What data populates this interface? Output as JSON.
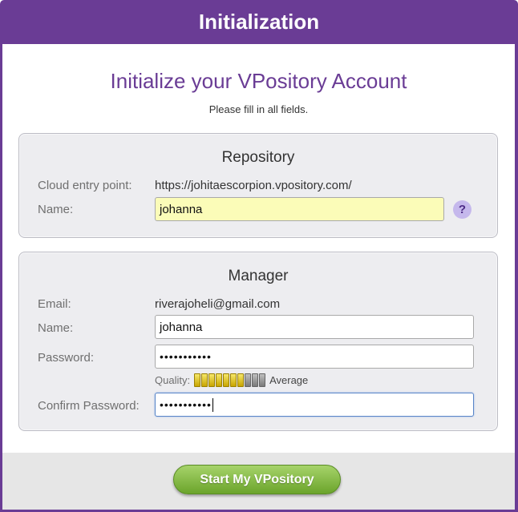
{
  "window": {
    "title": "Initialization"
  },
  "header": {
    "heading": "Initialize your VPository Account",
    "subheading": "Please fill in all fields."
  },
  "repository": {
    "title": "Repository",
    "cloud_label": "Cloud entry point:",
    "cloud_value": "https://johitaescorpion.vpository.com/",
    "name_label": "Name:",
    "name_value": "johanna",
    "help_symbol": "?"
  },
  "manager": {
    "title": "Manager",
    "email_label": "Email:",
    "email_value": "riverajoheli@gmail.com",
    "name_label": "Name:",
    "name_value": "johanna",
    "password_label": "Password:",
    "password_value": "•••••••••••",
    "quality_label": "Quality:",
    "quality_text": "Average",
    "quality_segments_total": 10,
    "quality_segments_filled": 7,
    "confirm_label": "Confirm Password:",
    "confirm_value": "•••••••••••"
  },
  "footer": {
    "start_label": "Start My VPository"
  },
  "colors": {
    "brand_purple": "#6a3c95",
    "field_highlight": "#fbfcb8",
    "button_green": "#7db33c"
  }
}
